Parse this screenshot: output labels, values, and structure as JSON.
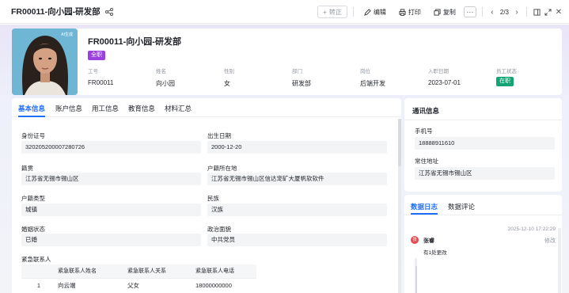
{
  "topbar": {
    "title": "FR00011-向小园-研发部",
    "transfer_label": "转正",
    "edit_label": "编辑",
    "print_label": "打印",
    "copy_label": "复制",
    "more_label": "···",
    "pager": "2/3"
  },
  "profile": {
    "name_title": "FR00011-向小园-研发部",
    "type_badge": "全职",
    "avatar_brand": "AI生成",
    "fields": [
      {
        "label": "工号",
        "value": "FR00011"
      },
      {
        "label": "姓名",
        "value": "向小园"
      },
      {
        "label": "性别",
        "value": "女"
      },
      {
        "label": "部门",
        "value": "研发部"
      },
      {
        "label": "岗位",
        "value": "后端开发"
      },
      {
        "label": "入职日期",
        "value": "2023-07-01"
      },
      {
        "label": "员工状态",
        "value": "在职"
      }
    ]
  },
  "main": {
    "tabs": [
      "基本信息",
      "账户信息",
      "用工信息",
      "教育信息",
      "材料汇总"
    ],
    "basic": {
      "id_label": "身份证号",
      "id_value": "320205200007280726",
      "birth_label": "出生日期",
      "birth_value": "2000-12-20",
      "origin_label": "籍贯",
      "origin_value": "江苏省无锡市锡山区",
      "hukou_loc_label": "户籍所在地",
      "hukou_loc_value": "江苏省无锡市锡山区信达宠矿大厦帆软软件",
      "hukou_type_label": "户籍类型",
      "hukou_type_value": "城镇",
      "ethnic_label": "民族",
      "ethnic_value": "汉族",
      "marital_label": "婚姻状态",
      "marital_value": "已婚",
      "politics_label": "政治面貌",
      "politics_value": "中共党员",
      "emergency_label": "紧急联系人"
    },
    "emergency_table": {
      "headers": [
        "",
        "紧急联系人姓名",
        "紧急联系人关系",
        "紧急联系人电话"
      ],
      "rows": [
        [
          "1",
          "向云端",
          "父女",
          "18000000000"
        ]
      ]
    }
  },
  "contact": {
    "title": "通讯信息",
    "phone_label": "手机号",
    "phone_value": "18888911610",
    "address_label": "常住地址",
    "address_value": "江苏省无锡市锡山区"
  },
  "log": {
    "tabs": [
      "数据日志",
      "数据评论"
    ],
    "time": "2025-12-10 17:22:29",
    "avatar_char": "张",
    "user": "张睿",
    "action": "修改",
    "summary": "有1处更改"
  },
  "colors": {
    "accent": "#1f6fff",
    "fulltime_badge": "#9b3fe0",
    "status_badge": "#12a474"
  }
}
